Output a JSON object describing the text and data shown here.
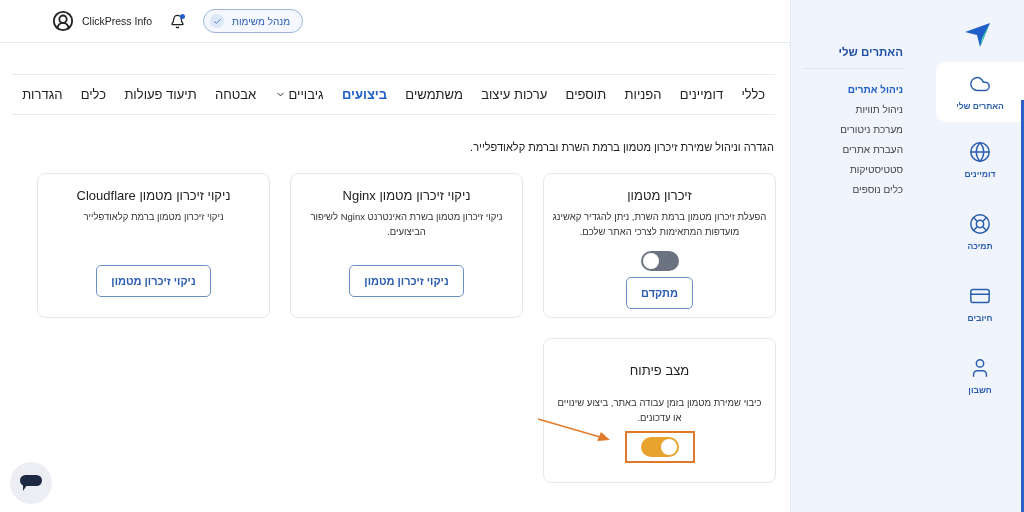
{
  "header": {
    "user_name": "ClickPress Info",
    "notifications_unread": true,
    "task_button": "מנהל משימות"
  },
  "tabs": [
    {
      "label": "כללי",
      "selected": false
    },
    {
      "label": "דומיינים",
      "selected": false
    },
    {
      "label": "הפניות",
      "selected": false
    },
    {
      "label": "תוספים",
      "selected": false
    },
    {
      "label": "ערכות עיצוב",
      "selected": false
    },
    {
      "label": "משתמשים",
      "selected": false
    },
    {
      "label": "ביצועים",
      "selected": true
    },
    {
      "label": "גיבויים",
      "selected": false,
      "dropdown": true
    },
    {
      "label": "אבטחה",
      "selected": false
    },
    {
      "label": "תיעוד פעולות",
      "selected": false
    },
    {
      "label": "כלים",
      "selected": false
    },
    {
      "label": "הגדרות",
      "selected": false
    }
  ],
  "description": "הגדרה וניהול שמירת זיכרון מטמון ברמת השרת וברמת קלאודפלייר.",
  "cards": [
    {
      "kind": "toggle",
      "title": "זיכרון מטמון",
      "text": "הפעלת זיכרון מטמון ברמת השרת, ניתן להגדיר קאשינג מועדפות המתאימות לצרכי האתר שלכם.",
      "on": false,
      "highlighted": false,
      "button": "מתקדם"
    },
    {
      "kind": "button",
      "title": "ניקוי זיכרון מטמון Nginx",
      "text": "ניקוי זיכרון מטמון בשרת האינטרנט Nginx לשיפור הביצועים.",
      "button": "ניקוי זיכרון מטמון"
    },
    {
      "kind": "button",
      "title": "ניקוי זיכרון מטמון Cloudflare",
      "text": "ניקוי זיכרון מטמון ברמת קלאודפלייר",
      "button": "ניקוי זיכרון מטמון"
    },
    {
      "kind": "toggle",
      "title": "מצב פיתוח",
      "text": "כיבוי שמירת מטמון בזמן עבודה באתר, ביצוע שינויים או עדכונים.",
      "on": true,
      "highlighted": true
    }
  ],
  "submenu": {
    "title": "האתרים שלי",
    "items": [
      {
        "label": "ניהול אתרים",
        "selected": true
      },
      {
        "label": "ניהול תוויות",
        "selected": false
      },
      {
        "label": "מערכת ניטורים",
        "selected": false
      },
      {
        "label": "העברת אתרים",
        "selected": false
      },
      {
        "label": "סטטיסטיקות",
        "selected": false
      },
      {
        "label": "כלים נוספים",
        "selected": false
      }
    ]
  },
  "rail": [
    {
      "label": "האתרים שלי",
      "selected": true
    },
    {
      "label": "דומיינים",
      "selected": false
    },
    {
      "label": "תמיכה",
      "selected": false
    },
    {
      "label": "חיובים",
      "selected": false
    },
    {
      "label": "חשבון",
      "selected": false
    }
  ]
}
